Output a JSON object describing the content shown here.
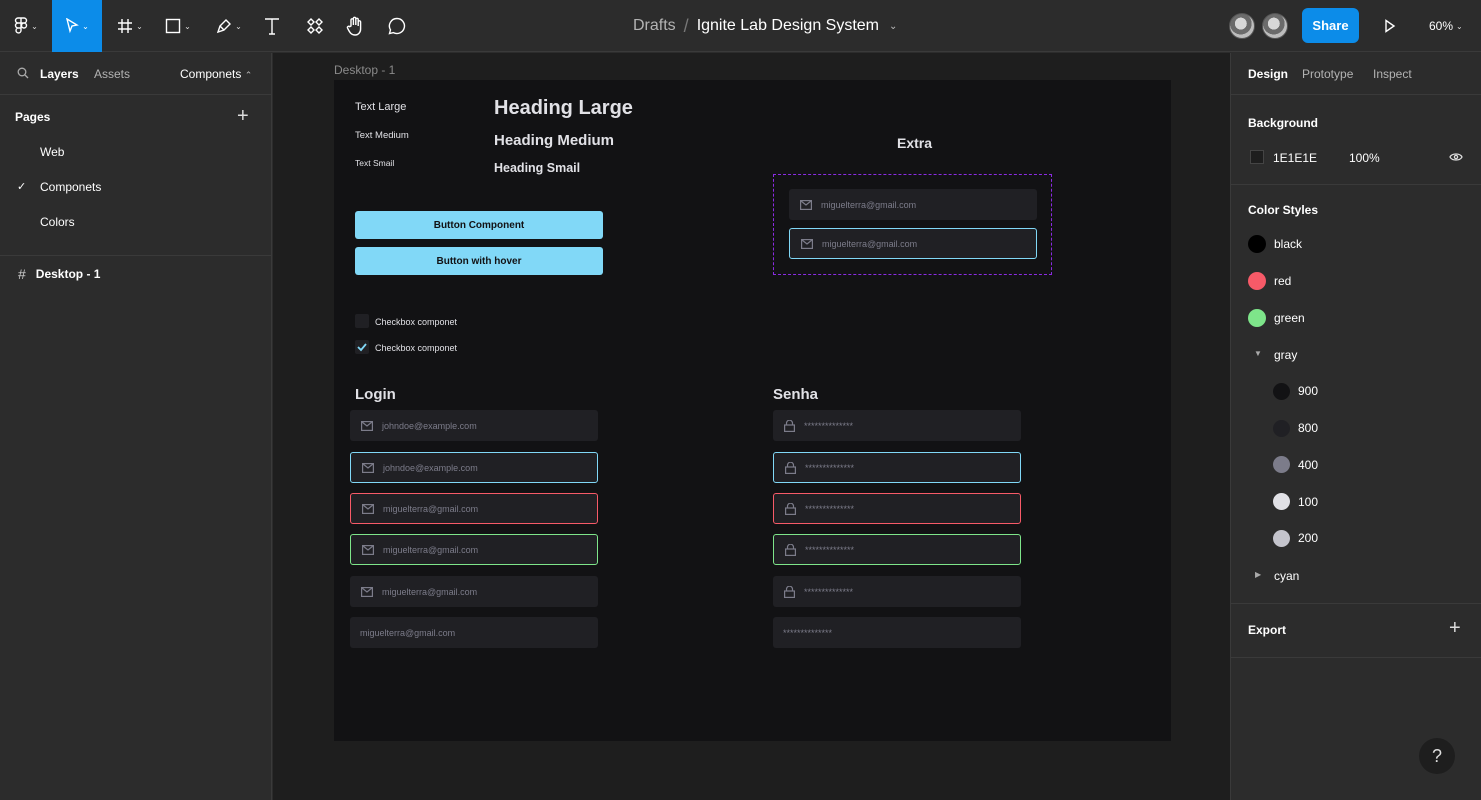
{
  "toolbar": {
    "doc_folder": "Drafts",
    "doc_name": "Ignite Lab Design System",
    "share_label": "Share",
    "zoom": "60%"
  },
  "left_panel": {
    "tabs": {
      "layers": "Layers",
      "assets": "Assets",
      "page_select": "Componets"
    },
    "pages_header": "Pages",
    "pages": [
      {
        "label": "Web",
        "selected": false
      },
      {
        "label": "Componets",
        "selected": true
      },
      {
        "label": "Colors",
        "selected": false
      }
    ],
    "layers": [
      {
        "label": "Desktop - 1"
      }
    ]
  },
  "canvas": {
    "frame_label": "Desktop - 1",
    "typography": {
      "text_large": "Text Large",
      "text_medium": "Text Medium",
      "text_small": "Text Smail",
      "heading_large": "Heading Large",
      "heading_medium": "Heading Medium",
      "heading_small": "Heading Smail"
    },
    "buttons": {
      "primary": "Button Component",
      "hover": "Button  with hover"
    },
    "checkboxes": [
      {
        "label": "Checkbox componet",
        "checked": false
      },
      {
        "label": "Checkbox componet",
        "checked": true
      }
    ],
    "extra": {
      "title": "Extra",
      "inputs": [
        "miguelterra@gmail.com",
        "miguelterra@gmail.com"
      ]
    },
    "login": {
      "title": "Login",
      "inputs": [
        "johndoe@example.com",
        "johndoe@example.com",
        "miguelterra@gmail.com",
        "miguelterra@gmail.com",
        "miguelterra@gmail.com",
        "miguelterra@gmail.com"
      ]
    },
    "senha": {
      "title": "Senha",
      "inputs": [
        "**************",
        "**************",
        "**************",
        "**************",
        "**************",
        "**************"
      ]
    }
  },
  "right_panel": {
    "tabs": {
      "design": "Design",
      "prototype": "Prototype",
      "inspect": "Inspect"
    },
    "background": {
      "header": "Background",
      "hex": "1E1E1E",
      "opacity": "100%"
    },
    "color_styles": {
      "header": "Color Styles",
      "top": [
        {
          "name": "black",
          "color": "#000000"
        },
        {
          "name": "red",
          "color": "#f75a68"
        },
        {
          "name": "green",
          "color": "#7ee58a"
        }
      ],
      "gray_group": "gray",
      "gray": [
        {
          "name": "900",
          "color": "#121214"
        },
        {
          "name": "800",
          "color": "#202024"
        },
        {
          "name": "400",
          "color": "#7c7c8a"
        },
        {
          "name": "100",
          "color": "#e1e1e6"
        },
        {
          "name": "200",
          "color": "#c4c4cc"
        }
      ],
      "cyan_group": "cyan"
    },
    "export_header": "Export",
    "help": "?"
  },
  "colors": {
    "accent": "#0c8ce9",
    "cyan": "#81d8f7",
    "red": "#f75a68",
    "green": "#7ee58a"
  }
}
